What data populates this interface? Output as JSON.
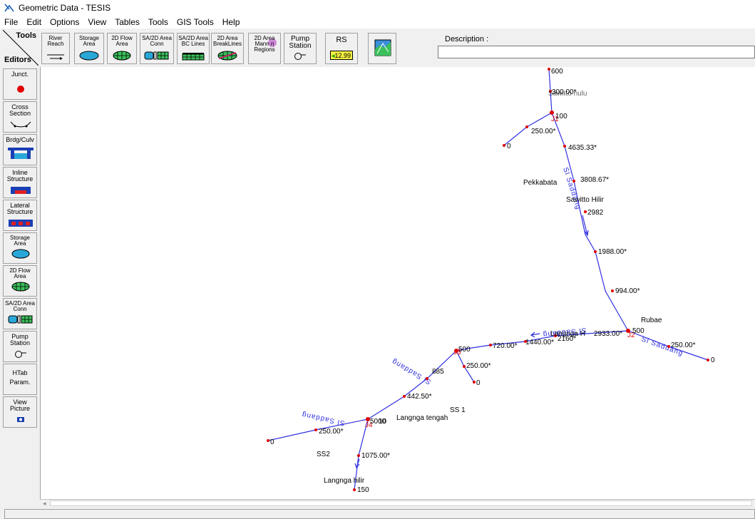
{
  "window": {
    "title": "Geometric Data - TESIS"
  },
  "menu": [
    "File",
    "Edit",
    "Options",
    "View",
    "Tables",
    "Tools",
    "GIS Tools",
    "Help"
  ],
  "toolbar": {
    "tools_label": "Tools",
    "editors_label": "Editors",
    "buttons": [
      {
        "l1": "River",
        "l2": "Reach"
      },
      {
        "l1": "Storage",
        "l2": "Area"
      },
      {
        "l1": "2D Flow",
        "l2": "Area"
      },
      {
        "l1": "SA/2D Area",
        "l2": "Conn"
      },
      {
        "l1": "SA/2D Area",
        "l2": "BC Lines"
      },
      {
        "l1": "2D Area",
        "l2": "BreakLines"
      },
      {
        "l1": "2D Area",
        "l2": "Mann n",
        "l3": "Regions"
      },
      {
        "l1": "Pump",
        "l2": "Station"
      },
      {
        "l1": "RS",
        "l2": "12.99"
      }
    ],
    "description_label": "Description :",
    "description_value": ""
  },
  "editors": [
    {
      "l1": "Junct.",
      "l2": ""
    },
    {
      "l1": "Cross",
      "l2": "Section"
    },
    {
      "l1": "Brdg/Culv",
      "l2": ""
    },
    {
      "l1": "Inline",
      "l2": "Structure"
    },
    {
      "l1": "Lateral",
      "l2": "Structure"
    },
    {
      "l1": "Storage",
      "l2": "Area"
    },
    {
      "l1": "2D Flow",
      "l2": "Area"
    },
    {
      "l1": "SA/2D Area",
      "l2": "Conn"
    },
    {
      "l1": "Pump",
      "l2": "Station"
    },
    {
      "l1": "HTab",
      "l2": "Param."
    },
    {
      "l1": "View",
      "l2": "Picture"
    }
  ],
  "map": {
    "river_color": "#3030e0",
    "node_color": "#e00000",
    "label_color": "#000000",
    "river_labels": [
      "Sl Saddang",
      "Sl Saddang",
      "Sl Saddang",
      "Sl Saddang",
      "Sl Saddang"
    ],
    "junctions": [
      "J1",
      "J2",
      "J3",
      "J4"
    ],
    "stations": [
      "600",
      "300.00*",
      "100",
      "250.00*",
      "0",
      "4635.33*",
      "3808.67*",
      "2982",
      "1988.00*",
      "994.00*",
      "500",
      "2933.00*",
      "250.00*",
      "0",
      "2160*",
      "1440.00*",
      "720.00*",
      "500",
      "250.00*",
      "0",
      "885",
      "442.50*",
      "5000",
      "10",
      "250.00*",
      "0",
      "1075.00*",
      "150"
    ],
    "reach_labels": [
      "Sawitto hulu",
      "Pekkabata",
      "Sawitto Hilir",
      "Rubae",
      "Langnga H",
      "Langnga tengah",
      "SS 1",
      "SS2",
      "Langnga hilir"
    ]
  }
}
